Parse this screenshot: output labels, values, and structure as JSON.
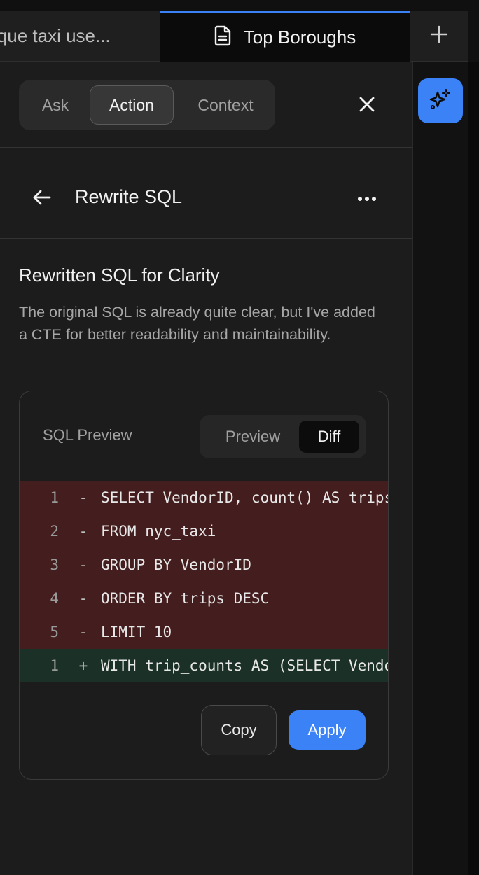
{
  "tabs": {
    "inactive_label": "ique taxi use...",
    "active_label": "Top Boroughs",
    "add_label": "+"
  },
  "mode_switch": {
    "items": [
      {
        "label": "Ask"
      },
      {
        "label": "Action"
      },
      {
        "label": "Context"
      }
    ],
    "selected": "Action"
  },
  "action_view": {
    "title": "Rewrite SQL"
  },
  "result": {
    "heading": "Rewritten SQL for Clarity",
    "description": "The original SQL is already quite clear, but I've added a CTE for better readability and maintainability."
  },
  "sql_card": {
    "label": "SQL Preview",
    "toggle": {
      "preview": "Preview",
      "diff": "Diff",
      "selected": "Diff"
    },
    "lines": [
      {
        "num": "1",
        "sign": "-",
        "code": "SELECT VendorID, count() AS trips",
        "type": "removed"
      },
      {
        "num": "2",
        "sign": "-",
        "code": "FROM nyc_taxi",
        "type": "removed"
      },
      {
        "num": "3",
        "sign": "-",
        "code": "GROUP BY VendorID",
        "type": "removed"
      },
      {
        "num": "4",
        "sign": "-",
        "code": "ORDER BY trips DESC",
        "type": "removed"
      },
      {
        "num": "5",
        "sign": "-",
        "code": "LIMIT 10",
        "type": "removed"
      },
      {
        "num": "1",
        "sign": "+",
        "code": "WITH trip_counts AS (SELECT VendorID",
        "type": "added"
      }
    ],
    "copy_label": "Copy",
    "apply_label": "Apply"
  },
  "colors": {
    "accent": "#3b82f6",
    "removed_bg": "#441e1e",
    "added_bg": "#1b3127"
  },
  "icons": {
    "tab_doc": "document-icon",
    "ai": "sparkles-icon",
    "close": "close-icon",
    "back": "arrow-left-icon",
    "more": "more-horizontal-icon"
  }
}
